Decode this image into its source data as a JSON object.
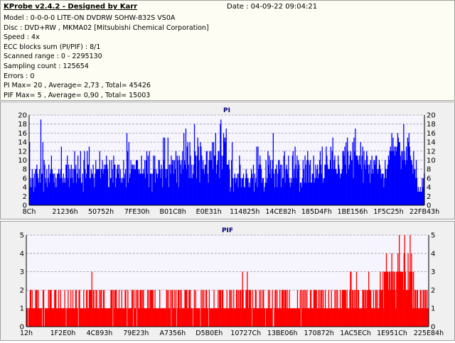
{
  "header": {
    "app_title": "KProbe v2.4.2 - Designed by Karr",
    "date": "Date : 04-09-22 09:04:21",
    "lines": [
      "Model : 0-0-0-0 LITE-ON DVDRW SOHW-832S  VS0A",
      "Disc : DVD+RW , MKMA02 [Mitsubishi Chemical Corporation]",
      "Speed : 4x",
      "ECC blocks sum (PI/PIF) : 8/1",
      "Scanned range : 0 - 2295130",
      "Sampling count : 125654",
      "Errors : 0",
      "PI Max= 20 , Average= 2,73 , Total= 45426",
      "PIF Max= 5 , Average= 0,90 , Total= 15003"
    ]
  },
  "colors": {
    "pi_bar": "#0000ff",
    "pif_bar": "#ff0000",
    "plot_bg": "#f6f4fc",
    "grid": "#9b9bb4",
    "title": "#000080"
  },
  "chart_data": [
    {
      "type": "bar",
      "title": "PI",
      "ylim": [
        0,
        20
      ],
      "yticks": [
        0,
        2,
        4,
        6,
        8,
        10,
        12,
        14,
        16,
        18,
        20
      ],
      "grid": true,
      "xtick_labels": [
        "8Ch",
        "21236h",
        "50752h",
        "7FE30h",
        "B01C8h",
        "E0E31h",
        "114825h",
        "14CE82h",
        "185D4Fh",
        "1BE156h",
        "1F5C25h",
        "22FB43h"
      ],
      "values": [
        14,
        4,
        6,
        4,
        8,
        6,
        3,
        7,
        4,
        8,
        8,
        9,
        7,
        6,
        5,
        8,
        5,
        19,
        7,
        7,
        14,
        3,
        10,
        9,
        6,
        5,
        8,
        4,
        6,
        9,
        5,
        7,
        8,
        11,
        8,
        7,
        7,
        5,
        7,
        4,
        6,
        4,
        7,
        7,
        8,
        7,
        6,
        8,
        13,
        6,
        5,
        7,
        5,
        6,
        5,
        9,
        9,
        11,
        6,
        9,
        4,
        8,
        6,
        9,
        6,
        8,
        5,
        8,
        12,
        8,
        9,
        5,
        7,
        11,
        6,
        8,
        6,
        12,
        5,
        5,
        7,
        3,
        10,
        12,
        8,
        6,
        7,
        12,
        9,
        9,
        13,
        6,
        6,
        8,
        7,
        7,
        9,
        6,
        4,
        7,
        10,
        8,
        8,
        8,
        8,
        8,
        12,
        6,
        8,
        8,
        10,
        7,
        8,
        9,
        8,
        9,
        11,
        9,
        8,
        4,
        4,
        10,
        6,
        6,
        10,
        8,
        5,
        11,
        9,
        9,
        4,
        6,
        8,
        9,
        7,
        9,
        6,
        8,
        5,
        6,
        5,
        6,
        10,
        6,
        7,
        8,
        4,
        16,
        12,
        5,
        14,
        6,
        7,
        10,
        8,
        9,
        9,
        8,
        9,
        8,
        8,
        10,
        10,
        10,
        8,
        7,
        8,
        7,
        7,
        11,
        7,
        7,
        8,
        7,
        10,
        6,
        10,
        12,
        7,
        11,
        4,
        12,
        7,
        7,
        7,
        3,
        7,
        11,
        8,
        11,
        5,
        8,
        7,
        6,
        7,
        10,
        10,
        8,
        6,
        9,
        8,
        4,
        15,
        10,
        15,
        8,
        6,
        8,
        8,
        15,
        4,
        9,
        9,
        7,
        11,
        9,
        10,
        10,
        7,
        10,
        8,
        12,
        5,
        11,
        10,
        4,
        11,
        10,
        9,
        7,
        10,
        12,
        8,
        16,
        10,
        9,
        17,
        8,
        13,
        14,
        9,
        6,
        14,
        11,
        6,
        9,
        6,
        7,
        9,
        18,
        12,
        11,
        6,
        11,
        15,
        13,
        10,
        5,
        14,
        13,
        11,
        8,
        10,
        8,
        7,
        9,
        9,
        12,
        12,
        7,
        5,
        10,
        12,
        10,
        12,
        10,
        14,
        8,
        14,
        11,
        11,
        16,
        7,
        9,
        10,
        12,
        12,
        6,
        18,
        19,
        11,
        8,
        11,
        16,
        15,
        14,
        15,
        17,
        9,
        9,
        9,
        10,
        8,
        3,
        4,
        10,
        14,
        6,
        3,
        6,
        7,
        5,
        6,
        6,
        7,
        4,
        7,
        11,
        9,
        6,
        4,
        6,
        6,
        7,
        4,
        4,
        6,
        8,
        7,
        6,
        6,
        4,
        5,
        4,
        6,
        8,
        7,
        6,
        9,
        3,
        7,
        5,
        6,
        13,
        4,
        13,
        8,
        9,
        11,
        9,
        8,
        5,
        6,
        6,
        3,
        4,
        5,
        10,
        5,
        6,
        12,
        9,
        11,
        7,
        10,
        6,
        8,
        10,
        16,
        7,
        4,
        8,
        8,
        9,
        4,
        7,
        10,
        10,
        8,
        9,
        4,
        9,
        6,
        6,
        11,
        12,
        5,
        8,
        9,
        8,
        7,
        11,
        6,
        5,
        4,
        6,
        5,
        11,
        12,
        6,
        8,
        13,
        9,
        6,
        11,
        8,
        10,
        9,
        3,
        5,
        5,
        4,
        6,
        10,
        8,
        5,
        11,
        9,
        5,
        10,
        12,
        10,
        5,
        9,
        10,
        5,
        5,
        7,
        7,
        11,
        5,
        6,
        9,
        6,
        8,
        9,
        6,
        7,
        10,
        12,
        9,
        7,
        13,
        5,
        6,
        6,
        9,
        9,
        13,
        11,
        9,
        8,
        8,
        8,
        10,
        13,
        8,
        12,
        15,
        8,
        10,
        11,
        8,
        8,
        7,
        7,
        11,
        9,
        8,
        6,
        7,
        7,
        8,
        12,
        12,
        11,
        13,
        9,
        14,
        7,
        15,
        12,
        8,
        9,
        11,
        12,
        10,
        10,
        14,
        6,
        15,
        12,
        17,
        11,
        11,
        11,
        10,
        9,
        11,
        9,
        14,
        8,
        11,
        13,
        5,
        12,
        9,
        10,
        8,
        12,
        11,
        9,
        7,
        9,
        5,
        10,
        7,
        11,
        8,
        7,
        10,
        10,
        9,
        11,
        11,
        8,
        7,
        8,
        10,
        9,
        8,
        6,
        7,
        7,
        7,
        4,
        6,
        10,
        8,
        6,
        8,
        9,
        11,
        10,
        12,
        13,
        12,
        16,
        12,
        15,
        12,
        13,
        11,
        13,
        12,
        13,
        16,
        15,
        14,
        14,
        11,
        8,
        12,
        12,
        10,
        18,
        12,
        10,
        9,
        13,
        10,
        15,
        14,
        16,
        13,
        11,
        10,
        10,
        9,
        7,
        12,
        8,
        8,
        6,
        10,
        6,
        3,
        4,
        3,
        3,
        4,
        3,
        3,
        6,
        4,
        6,
        7
      ]
    },
    {
      "type": "bar",
      "title": "PIF",
      "ylim": [
        0,
        5
      ],
      "yticks": [
        0,
        1,
        2,
        3,
        4,
        5
      ],
      "grid": true,
      "xtick_labels": [
        "12h",
        "1F2E0h",
        "4C893h",
        "79E23h",
        "A7356h",
        "D5B0Eh",
        "10727Ch",
        "13BE06h",
        "170872h",
        "1AC5ECh",
        "1E951Ch",
        "225E84h"
      ],
      "values": [
        1,
        1,
        0,
        1,
        1,
        2,
        2,
        1,
        2,
        1,
        1,
        1,
        1,
        2,
        2,
        2,
        1,
        2,
        1,
        1,
        1,
        1,
        1,
        0,
        2,
        2,
        0,
        1,
        1,
        1,
        1,
        1,
        2,
        1,
        2,
        2,
        2,
        1,
        1,
        1,
        1,
        2,
        2,
        2,
        1,
        1,
        1,
        2,
        1,
        1,
        2,
        1,
        1,
        1,
        1,
        1,
        2,
        1,
        0,
        1,
        1,
        2,
        1,
        1,
        1,
        2,
        1,
        1,
        2,
        1,
        1,
        1,
        2,
        2,
        1,
        1,
        0,
        2,
        2,
        1,
        1,
        1,
        1,
        1,
        2,
        1,
        1,
        1,
        2,
        2,
        1,
        1,
        2,
        2,
        2,
        2,
        3,
        1,
        2,
        2,
        1,
        1,
        2,
        2,
        1,
        1,
        1,
        2,
        1,
        2,
        2,
        1,
        1,
        2,
        2,
        1,
        1,
        1,
        1,
        1,
        1,
        1,
        1,
        1,
        2,
        2,
        2,
        0,
        2,
        1,
        2,
        2,
        2,
        1,
        1,
        1,
        2,
        1,
        1,
        1,
        2,
        1,
        1,
        1,
        1,
        2,
        2,
        1,
        0,
        2,
        1,
        1,
        1,
        1,
        1,
        2,
        2,
        0,
        2,
        1,
        1,
        2,
        0,
        2,
        2,
        1,
        1,
        2,
        2,
        2,
        1,
        2,
        2,
        1,
        1,
        1,
        1,
        1,
        2,
        1,
        2,
        1,
        2,
        2,
        2,
        2,
        2,
        1,
        1,
        2,
        1,
        1,
        1,
        1,
        1,
        1,
        2,
        1,
        1,
        1,
        1,
        1,
        1,
        1,
        1,
        1,
        2,
        2,
        1,
        2,
        1,
        1,
        2,
        0,
        2,
        2,
        1,
        1,
        2,
        1,
        2,
        0,
        1,
        2,
        2,
        1,
        2,
        1,
        2,
        1,
        1,
        1,
        1,
        2,
        2,
        2,
        2,
        1,
        1,
        2,
        2,
        2,
        1,
        1,
        1,
        0,
        1,
        2,
        1,
        2,
        1,
        1,
        1,
        1,
        1,
        1,
        0,
        2,
        1,
        2,
        1,
        2,
        1,
        1,
        2,
        2,
        1,
        1,
        0,
        2,
        1,
        1,
        1,
        1,
        1,
        1,
        2,
        1,
        1,
        1,
        1,
        1,
        2,
        1,
        2,
        2,
        2,
        1,
        2,
        2,
        1,
        1,
        1,
        1,
        1,
        2,
        1,
        1,
        1,
        2,
        2,
        1,
        2,
        1,
        1,
        2,
        1,
        1,
        1,
        2,
        2,
        1,
        2,
        1,
        2,
        2,
        1,
        2,
        3,
        2,
        1,
        1,
        1,
        2,
        2,
        3,
        2,
        1,
        2,
        2,
        2,
        1,
        0,
        2,
        1,
        1,
        1,
        2,
        2,
        1,
        1,
        1,
        1,
        2,
        1,
        2,
        1,
        1,
        2,
        2,
        1,
        1,
        0,
        1,
        1,
        1,
        2,
        1,
        2,
        1,
        1,
        1,
        2,
        0,
        0,
        1,
        2,
        2,
        1,
        2,
        1,
        1,
        1,
        2,
        1,
        1,
        2,
        2,
        2,
        1,
        2,
        2,
        2,
        1,
        2,
        1,
        1,
        2,
        1,
        1,
        1,
        1,
        1,
        1,
        1,
        1,
        1,
        1,
        1,
        2,
        1,
        1,
        1,
        2,
        0,
        2,
        1,
        2,
        1,
        2,
        1,
        2,
        1,
        2,
        1,
        1,
        1,
        1,
        2,
        2,
        1,
        1,
        1,
        2,
        2,
        2,
        2,
        2,
        1,
        1,
        2,
        1,
        2,
        1,
        2,
        2,
        1,
        2,
        1,
        1,
        2,
        1,
        1,
        1,
        1,
        2,
        1,
        1,
        1,
        2,
        1,
        1,
        1,
        1,
        2,
        1,
        2,
        1,
        2,
        1,
        1,
        1,
        2,
        1,
        1,
        2,
        2,
        2,
        2,
        2,
        2,
        1,
        2,
        1,
        1,
        1,
        2,
        3,
        3,
        1,
        2,
        2,
        1,
        2,
        1,
        2,
        3,
        1,
        2,
        2,
        1,
        1,
        1,
        1,
        1,
        2,
        2,
        2,
        1,
        2,
        2,
        1,
        2,
        2,
        3,
        2,
        2,
        2,
        1,
        1,
        1,
        2,
        1,
        1,
        2,
        2,
        1,
        2,
        1,
        1,
        2,
        3,
        2,
        2,
        2,
        3,
        1,
        3,
        3,
        3,
        4,
        3,
        3,
        2,
        3,
        3,
        2,
        3,
        4,
        3,
        2,
        3,
        3,
        2,
        1,
        3,
        3,
        4,
        3,
        5,
        3,
        3,
        3,
        3,
        3,
        2,
        4,
        5,
        3,
        2,
        2,
        2,
        4,
        2,
        3,
        5,
        3,
        4,
        3,
        1,
        3,
        1,
        2,
        2,
        1,
        2,
        2,
        1,
        1,
        1,
        2,
        2,
        1,
        1,
        2,
        2,
        1,
        2,
        2,
        1,
        2,
        1,
        1
      ]
    }
  ]
}
